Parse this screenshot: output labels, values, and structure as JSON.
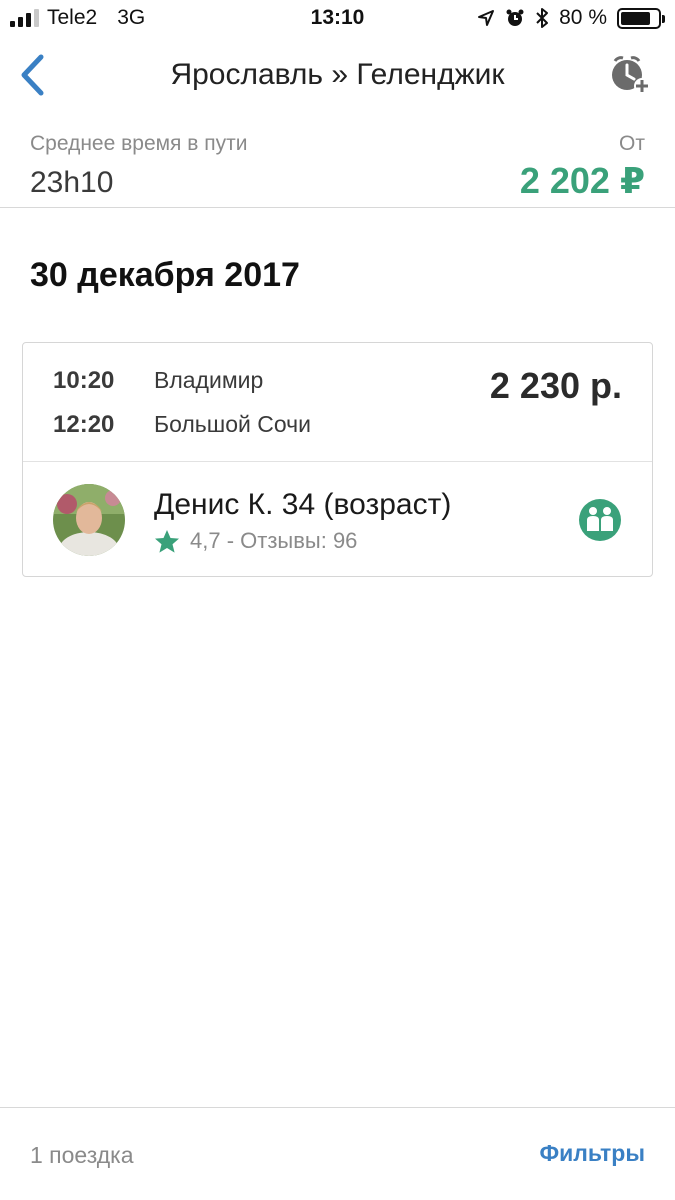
{
  "status_bar": {
    "carrier": "Tele2",
    "network": "3G",
    "time": "13:10",
    "battery_percent": "80 %",
    "battery_level": 0.8
  },
  "nav": {
    "title": "Ярославль » Геленджик",
    "back_icon": "chevron-left-icon",
    "alarm_icon": "alarm-add-icon"
  },
  "summary": {
    "avg_time_label": "Среднее время в пути",
    "avg_time_value": "23h10",
    "from_label": "От",
    "from_price": "2 202 ₽"
  },
  "date_heading": "30 декабря 2017",
  "trip": {
    "departure_time": "10:20",
    "departure_place": "Владимир",
    "arrival_time": "12:20",
    "arrival_place": "Большой Сочи",
    "price": "2 230 р.",
    "driver": {
      "name": "Денис К. 34 (возраст)",
      "rating_text": "4,7 - Отзывы: 96"
    }
  },
  "footer": {
    "trip_count": "1 поездка",
    "filters_label": "Фильтры"
  },
  "colors": {
    "accent_green": "#3aa17a",
    "link_blue": "#3a80c4",
    "muted": "#8a8a8a"
  }
}
